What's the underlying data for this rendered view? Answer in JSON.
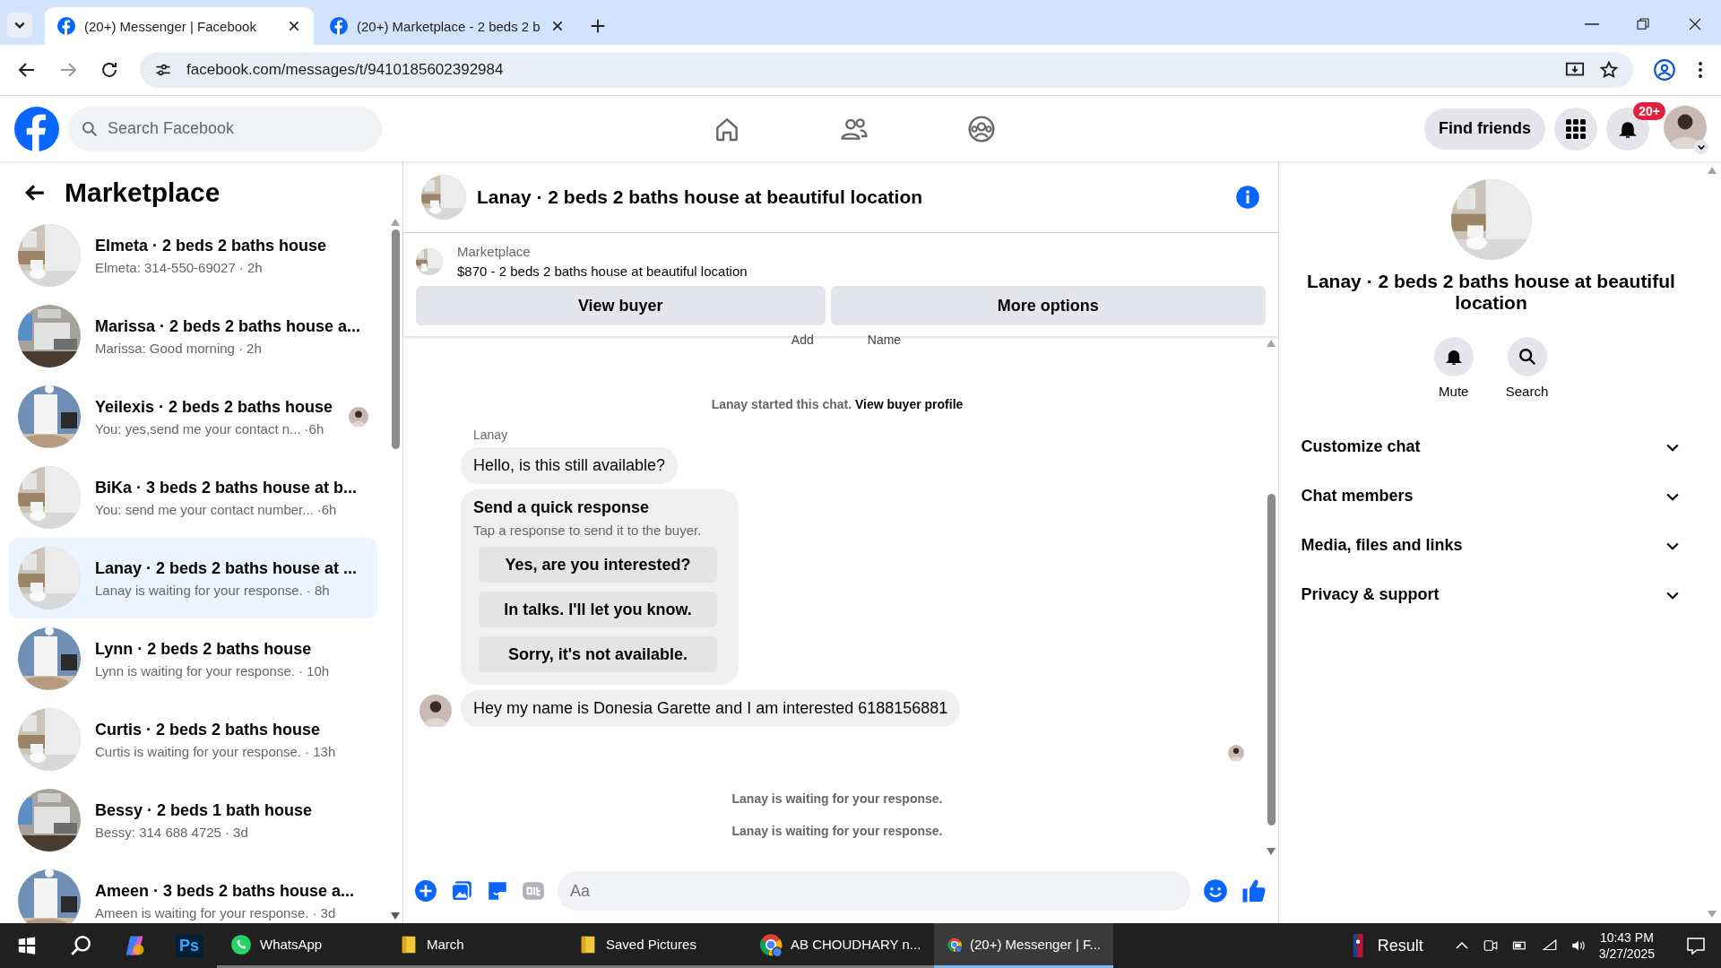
{
  "browser": {
    "tabs": [
      {
        "title": "(20+) Messenger | Facebook",
        "selected": true
      },
      {
        "title": "(20+) Marketplace - 2 beds 2 b",
        "selected": false
      }
    ],
    "url": "facebook.com/messages/t/9410185602392984"
  },
  "header": {
    "search_placeholder": "Search Facebook",
    "find_friends": "Find friends",
    "notification_count": "20+"
  },
  "sidebar": {
    "title": "Marketplace",
    "conversations": [
      {
        "title": "Elmeta · 2 beds 2 baths house",
        "preview": "Elmeta: 314-550-69027",
        "time": "· 2h",
        "selected": false,
        "seen": false
      },
      {
        "title": "Marissa · 2 beds 2 baths house a...",
        "preview": "Marissa: Good morning",
        "time": "· 2h",
        "selected": false,
        "seen": false
      },
      {
        "title": "Yeilexis · 2 beds 2 baths house",
        "preview": "You: yes,send me your contact n...",
        "time": "·6h",
        "selected": false,
        "seen": true
      },
      {
        "title": "BiKa · 3 beds 2 baths house at b...",
        "preview": "You: send me your contact number...",
        "time": "·6h",
        "selected": false,
        "seen": false
      },
      {
        "title": "Lanay · 2 beds 2 baths house at ...",
        "preview": "Lanay is waiting for your response.",
        "time": "· 8h",
        "selected": true,
        "seen": false
      },
      {
        "title": "Lynn · 2 beds 2 baths house",
        "preview": "Lynn is waiting for your response.",
        "time": "· 10h",
        "selected": false,
        "seen": false
      },
      {
        "title": "Curtis · 2 beds 2 baths house",
        "preview": "Curtis is waiting for your response.",
        "time": "· 13h",
        "selected": false,
        "seen": false
      },
      {
        "title": "Bessy · 2 beds 1 bath house",
        "preview": "Bessy: 314 688 4725",
        "time": "· 3d",
        "selected": false,
        "seen": false
      },
      {
        "title": "Ameen · 3 beds 2 baths house a...",
        "preview": "Ameen is waiting for your response.",
        "time": "· 3d",
        "selected": false,
        "seen": false
      }
    ]
  },
  "chat": {
    "title": "Lanay · 2 beds 2 baths house at beautiful location",
    "listing": {
      "source": "Marketplace",
      "text": "$870 - 2 beds 2 baths house at beautiful location",
      "buttons": [
        "View buyer",
        "More options"
      ]
    },
    "partial_labels": [
      "Add",
      "Name"
    ],
    "messages": [
      {
        "kind": "notice",
        "text": "Lanay started this chat.",
        "link": "View buyer profile"
      },
      {
        "kind": "incoming",
        "sender": "Lanay",
        "text": "Hello, is this still available?",
        "avatar": false
      },
      {
        "kind": "quick_reply",
        "title": "Send a quick response",
        "subtitle": "Tap a response to send it to the buyer.",
        "options": [
          "Yes, are you interested?",
          "In talks. I'll let you know.",
          "Sorry, it's not available."
        ]
      },
      {
        "kind": "incoming",
        "text": "Hey my name is Donesia Garette and I am interested 6188156881",
        "avatar": true
      },
      {
        "kind": "seen"
      },
      {
        "kind": "status",
        "text": "Lanay is waiting for your response."
      },
      {
        "kind": "status",
        "text": "Lanay is waiting for your response."
      }
    ],
    "composer_placeholder": "Aa"
  },
  "details": {
    "title": "Lanay · 2 beds 2 baths house at beautiful location",
    "actions": [
      {
        "kind": "mute",
        "label": "Mute"
      },
      {
        "kind": "search",
        "label": "Search"
      }
    ],
    "sections": [
      {
        "label": "Customize chat",
        "expanded": false
      },
      {
        "label": "Chat members",
        "expanded": false
      },
      {
        "label": "Media, files and links",
        "expanded": false
      },
      {
        "label": "Privacy & support",
        "expanded": false
      }
    ]
  },
  "taskbar": {
    "apps": [
      {
        "kind": "photoshop",
        "label": "Ps"
      },
      {
        "kind": "whatsapp",
        "label": "WhatsApp",
        "selected": false
      },
      {
        "kind": "folder",
        "label": "March",
        "selected": false
      },
      {
        "kind": "folder",
        "label": "Saved Pictures",
        "selected": false
      },
      {
        "kind": "chrome",
        "label": "AB CHOUDHARY n...",
        "selected": false
      },
      {
        "kind": "chrome",
        "label": "(20+) Messenger | F...",
        "selected": true
      }
    ],
    "weather": "Result",
    "time": "10:43 PM",
    "date": "3/27/2025"
  }
}
